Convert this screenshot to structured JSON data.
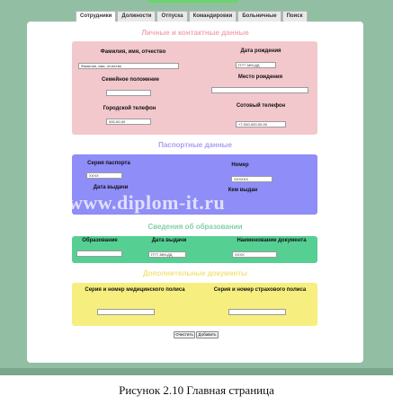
{
  "tabs": [
    "Сотрудники",
    "Должности",
    "Отпуска",
    "Командировки",
    "Больничные",
    "Поиск"
  ],
  "sections": {
    "personal": {
      "title": "Личные и контактные данные",
      "fio_label": "Фамилия, имя, отчество",
      "fio_value": "Фамилия, имя, отчество",
      "birth_date_label": "Дата рождения",
      "birth_date_value": "ГГГГ-ММ-ДД",
      "family_status_label": "Семейное положение",
      "birth_place_label": "Место рождения",
      "city_phone_label": "Городской телефон",
      "city_phone_value": "000-00-00",
      "mobile_phone_label": "Сотовый телефон",
      "mobile_phone_value": "+7-000-000-00-00"
    },
    "passport": {
      "title": "Паспортные данные",
      "series_label": "Серия паспорта",
      "series_value": "XXXX",
      "number_label": "Номер",
      "number_value": "XXXXXX",
      "issue_date_label": "Дата выдачи",
      "issued_by_label": "Кем выдан"
    },
    "education": {
      "title": "Сведения об образовании",
      "education_label": "Образование",
      "issue_date_label": "Дата выдачи",
      "issue_date_value": "ГГГГ-ММ-ДД",
      "doc_name_label": "Наименование документа",
      "doc_name_value": "XXXX"
    },
    "additional": {
      "title": "Дополнительные документы",
      "medical_policy_label": "Серия и номер медицинского полиса",
      "insurance_policy_label": "Серия и номер страхового полиса"
    }
  },
  "buttons": {
    "clear": "Очистить",
    "add": "Добавить"
  },
  "watermark": "www.diplom-it.ru",
  "caption": "Рисунок 2.10 Главная страница",
  "colors": {
    "background": "#92bfa3",
    "personal": "#f2c8cd",
    "passport": "#8f8df7",
    "education": "#56cf93",
    "additional": "#f6ef7f"
  }
}
